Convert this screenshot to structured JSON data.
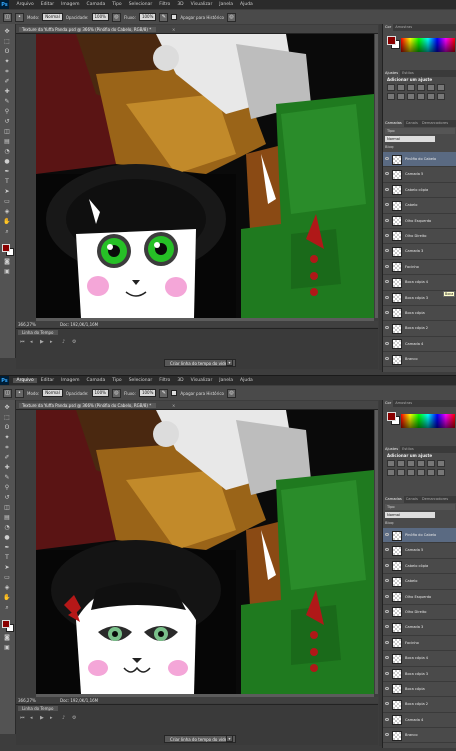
{
  "menus": [
    "Arquivo",
    "Editar",
    "Imagem",
    "Camada",
    "Tipo",
    "Selecionar",
    "Filtro",
    "3D",
    "Visualizar",
    "Janela",
    "Ajuda"
  ],
  "app_logo": "Ps",
  "options": {
    "mode_label": "Modo:",
    "mode_value": "Normal",
    "opacity_label": "Opacidade:",
    "opacity_value": "100%",
    "flow_label": "Fluxo:",
    "flow_value": "100%",
    "history_label": "Apagar para Histórico"
  },
  "panels": {
    "color_tabs": [
      "Cor",
      "Amostras"
    ],
    "adjust_tabs": [
      "Ajustes",
      "Estilos"
    ],
    "adjust_title": "Adicionar um ajuste",
    "layers_tabs": [
      "Camadas",
      "Canais",
      "Demarcadores"
    ],
    "filter_label": "Tipo",
    "blend_mode": "Normal",
    "lock_label": "Bloq:"
  },
  "timeline": {
    "tab_label": "Linha do Tempo",
    "create_video_label": "Criar linha do tempo do vídeo"
  },
  "shot1": {
    "doc_title": "Texture da Yuffa Panda.psd @ 366% (Pinófia do Cabelo, RGB/8) *",
    "zoom": "366,27%",
    "doc_info": "Doc: 192,0K/1,16M",
    "selected_menu": null,
    "layers": [
      "Pinófia do Cabelo",
      "Camada 5",
      "Cabelo cópia",
      "Cabelo",
      "Olho Esquerdo",
      "Olho Direito",
      "Camada 3",
      "Focinho",
      "Boca cópia 4",
      "Boca cópia 3",
      "Boca cópia",
      "Boca cópia 2",
      "Camada 4",
      "Branco"
    ],
    "tooltip": "Boca"
  },
  "shot2": {
    "doc_title": "Texture da Yuffa Panda.psd @ 366% (Pinófia do Cabelo, RGB/8) *",
    "zoom": "366,27%",
    "doc_info": "Doc: 192,0K/1,16M",
    "selected_menu": "Arquivo",
    "layers": [
      "Pinófia do Cabelo",
      "Camada 5",
      "Cabelo cópia",
      "Cabelo",
      "Olho Esquerdo",
      "Olho Direito",
      "Camada 3",
      "Focinho",
      "Boca cópia 4",
      "Boca cópia 3",
      "Boca cópia",
      "Boca cópia 2",
      "Camada 4",
      "Branco"
    ]
  },
  "colors": {
    "foreground": "#8a0000",
    "selected_layer": "#5a6a82",
    "panel": "#4a4a4a"
  }
}
